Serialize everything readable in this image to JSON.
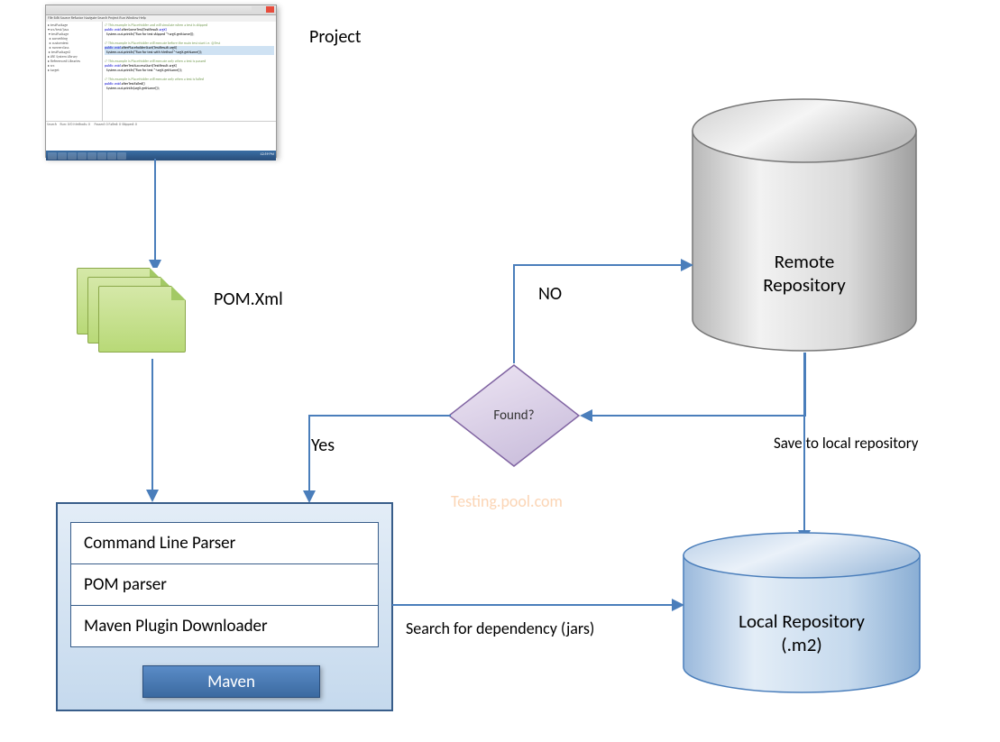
{
  "labels": {
    "project": "Project",
    "pom": "POM.Xml",
    "yes": "Yes",
    "no": "NO",
    "found": "Found?",
    "search": "Search for dependency (jars)",
    "save": "Save to local repository",
    "remote": "Remote Repository",
    "local_line1": "Local Repository",
    "local_line2": "(.m2)",
    "watermark": "Testing.pool.com"
  },
  "maven": {
    "item1": "Command Line Parser",
    "item2": "POM parser",
    "item3": "Maven Plugin Downloader",
    "badge": "Maven"
  },
  "ide": {
    "menu": "File Edit Source Refactor Navigate Search Project Run Window Help"
  }
}
